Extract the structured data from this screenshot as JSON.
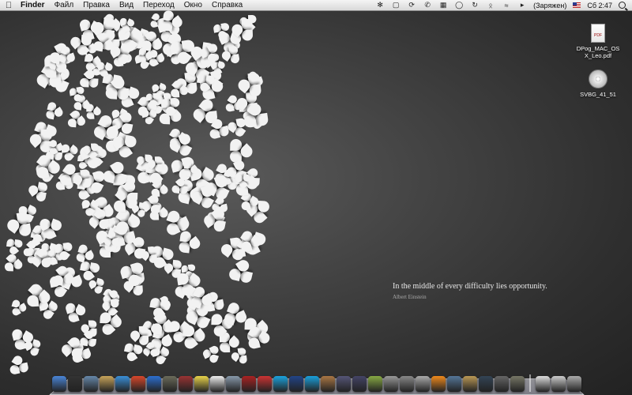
{
  "menubar": {
    "apple_icon": "apple-icon",
    "app_name": "Finder",
    "items": [
      "Файл",
      "Правка",
      "Вид",
      "Переход",
      "Окно",
      "Справка"
    ],
    "status_icons": [
      "growl-icon",
      "screen-icon",
      "sync-icon",
      "phone-icon",
      "one-icon",
      "chat-icon",
      "time-machine-icon",
      "bluetooth-icon",
      "wifi-icon",
      "volume-icon"
    ],
    "battery_label": "(Заряжен)",
    "input_flag": "us-flag-icon",
    "clock": "Сб 2:47"
  },
  "quote": {
    "text": "In the middle of every difficulty lies opportunity.",
    "author": "Albert Einstein"
  },
  "desktop_icons": [
    {
      "label": "DPog_MAC_OS X_Leo.pdf",
      "icon": "pdf-file-icon"
    },
    {
      "label": "SVBG_41_51",
      "icon": "disc-icon"
    }
  ],
  "dock": {
    "apps": [
      {
        "icon": "finder-icon",
        "color": "#4a86d8"
      },
      {
        "icon": "dashboard-icon",
        "color": "#333333"
      },
      {
        "icon": "preview-icon",
        "color": "#6688aa"
      },
      {
        "icon": "address-book-icon",
        "color": "#c8a45a"
      },
      {
        "icon": "safari-icon",
        "color": "#3a8fd8"
      },
      {
        "icon": "chrome-icon",
        "color": "#d9472b"
      },
      {
        "icon": "itunes-icon",
        "color": "#2c6fd0"
      },
      {
        "icon": "iphoto-icon",
        "color": "#6b6b5a"
      },
      {
        "icon": "photo-booth-icon",
        "color": "#993333"
      },
      {
        "icon": "stickies-icon",
        "color": "#e8d34a"
      },
      {
        "icon": "calendar-icon",
        "color": "#eeeeee"
      },
      {
        "icon": "mail-icon",
        "color": "#8899aa"
      },
      {
        "icon": "acrobat-icon",
        "color": "#aa2222"
      },
      {
        "icon": "forward-icon",
        "color": "#cc3333"
      },
      {
        "icon": "skype-icon",
        "color": "#1aa3e0"
      },
      {
        "icon": "penguin-icon",
        "color": "#224488"
      },
      {
        "icon": "skype-blue-icon",
        "color": "#19a0dd"
      },
      {
        "icon": "brown-box-icon",
        "color": "#aa7744"
      },
      {
        "icon": "brush-icon",
        "color": "#555577"
      },
      {
        "icon": "pen-icon",
        "color": "#444466"
      },
      {
        "icon": "colors-icon",
        "color": "#88aa44"
      },
      {
        "icon": "photo-icon",
        "color": "#999999"
      },
      {
        "icon": "utilities-icon",
        "color": "#888888"
      },
      {
        "icon": "disk-icon",
        "color": "#aaaaaa"
      },
      {
        "icon": "vlc-icon",
        "color": "#f08a1c"
      },
      {
        "icon": "network-icon",
        "color": "#557799"
      },
      {
        "icon": "archive-icon",
        "color": "#bb9955"
      },
      {
        "icon": "monitor-icon",
        "color": "#334455"
      },
      {
        "icon": "activity-icon",
        "color": "#666666"
      },
      {
        "icon": "tools-icon",
        "color": "#777766"
      }
    ],
    "stacks": [
      {
        "icon": "documents-stack-icon",
        "color": "#dddddd"
      },
      {
        "icon": "downloads-stack-icon",
        "color": "#cccccc"
      },
      {
        "icon": "trash-icon",
        "color": "#aaaaaa"
      }
    ]
  }
}
